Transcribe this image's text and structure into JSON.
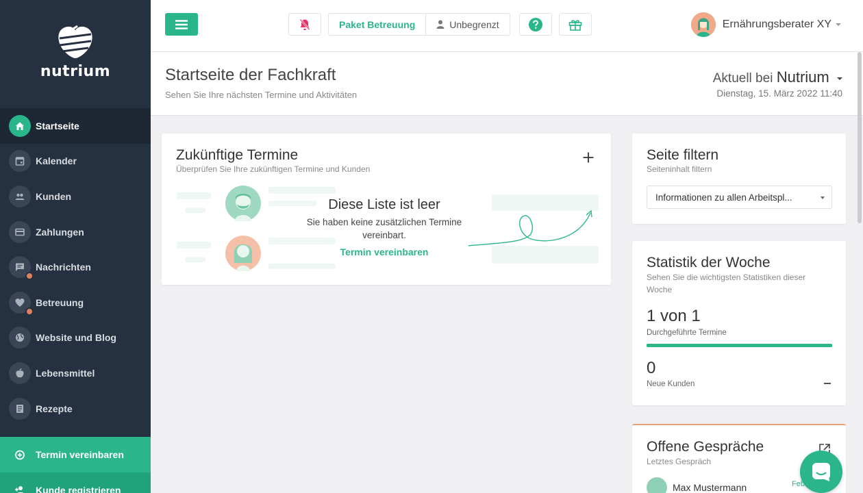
{
  "sidebar": {
    "logo_text": "nutrium",
    "items": [
      {
        "label": "Startseite",
        "icon": "home-icon",
        "active": true
      },
      {
        "label": "Kalender",
        "icon": "calendar-icon"
      },
      {
        "label": "Kunden",
        "icon": "people-icon"
      },
      {
        "label": "Zahlungen",
        "icon": "card-icon"
      },
      {
        "label": "Nachrichten",
        "icon": "chat-icon"
      },
      {
        "label": "Betreuung",
        "icon": "heart-icon"
      },
      {
        "label": "Website und Blog",
        "icon": "globe-icon"
      },
      {
        "label": "Lebensmittel",
        "icon": "apple-icon"
      },
      {
        "label": "Rezepte",
        "icon": "recipe-icon"
      }
    ],
    "cta_primary": "Termin vereinbaren",
    "cta_secondary": "Kunde registrieren"
  },
  "topbar": {
    "package_label": "Paket Betreuung",
    "limit_label": "Unbegrenzt",
    "user_name": "Ernährungsberater XY"
  },
  "header": {
    "title": "Startseite der Fachkraft",
    "subtitle": "Sehen Sie Ihre nächsten Termine und Aktivitäten",
    "practice_prefix": "Aktuell bei",
    "practice_name": "Nutrium",
    "date": "Dienstag, 15. März 2022 11:40"
  },
  "appointments": {
    "title": "Zukünftige Termine",
    "subtitle": "Überprüfen Sie Ihre zukünftigen Termine und Kunden",
    "empty_title": "Diese Liste ist leer",
    "empty_text": "Sie haben keine zusätzlichen Termine vereinbart.",
    "empty_link": "Termin vereinbaren"
  },
  "filter": {
    "title": "Seite filtern",
    "subtitle": "Seiteninhalt filtern",
    "selected": "Informationen zu allen Arbeitspl..."
  },
  "stats": {
    "title": "Statistik der Woche",
    "subtitle": "Sehen Sie die wichtigsten Statistiken dieser Woche",
    "appointments_value": "1 von 1",
    "appointments_label": "Durchgeführte Termine",
    "appointments_progress": 1.0,
    "clients_value": "0",
    "clients_label": "Neue Kunden"
  },
  "chats": {
    "title": "Offene Gespräche",
    "subtitle": "Letztes Gespräch",
    "last_name": "Max Mustermann",
    "last_date": "Feb"
  },
  "colors": {
    "accent": "#2bb58b",
    "sidebar": "#253040",
    "badge": "#e0805f"
  }
}
